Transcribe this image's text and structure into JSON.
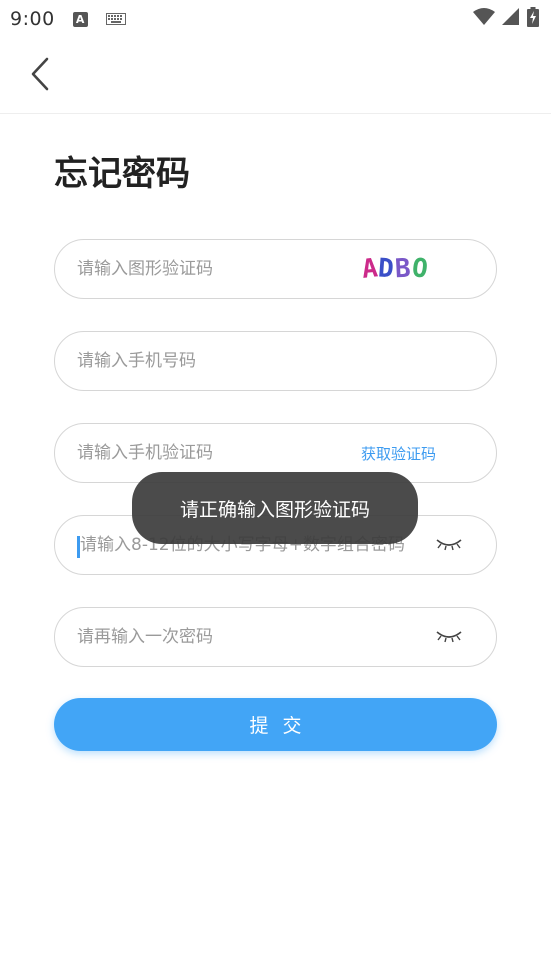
{
  "status_bar": {
    "time": "9:00",
    "a_icon": "A",
    "icons": [
      "a-notification-icon",
      "keyboard-icon",
      "wifi-icon",
      "signal-icon",
      "battery-charging-icon"
    ]
  },
  "nav": {
    "back_icon": "chevron-left-icon"
  },
  "page": {
    "title": "忘记密码"
  },
  "form": {
    "captcha": {
      "placeholder": "请输入图形验证码",
      "value": "",
      "captcha_text": "ADBO",
      "captcha_colors": [
        "#cc2a8a",
        "#3a4fc8",
        "#7a58c8",
        "#3fb26a"
      ]
    },
    "phone": {
      "placeholder": "请输入手机号码",
      "value": ""
    },
    "sms_code": {
      "placeholder": "请输入手机验证码",
      "value": "",
      "get_code_label": "获取验证码"
    },
    "password": {
      "placeholder": "请输入8-12位的大小写字母+数字组合密码",
      "value": ""
    },
    "confirm_password": {
      "placeholder": "请再输入一次密码",
      "value": ""
    },
    "submit_label": "提交"
  },
  "toast": {
    "message": "请正确输入图形验证码"
  },
  "colors": {
    "accent": "#42a5f6",
    "link": "#3d9bf0",
    "toast_bg": "#3c3c3c"
  }
}
